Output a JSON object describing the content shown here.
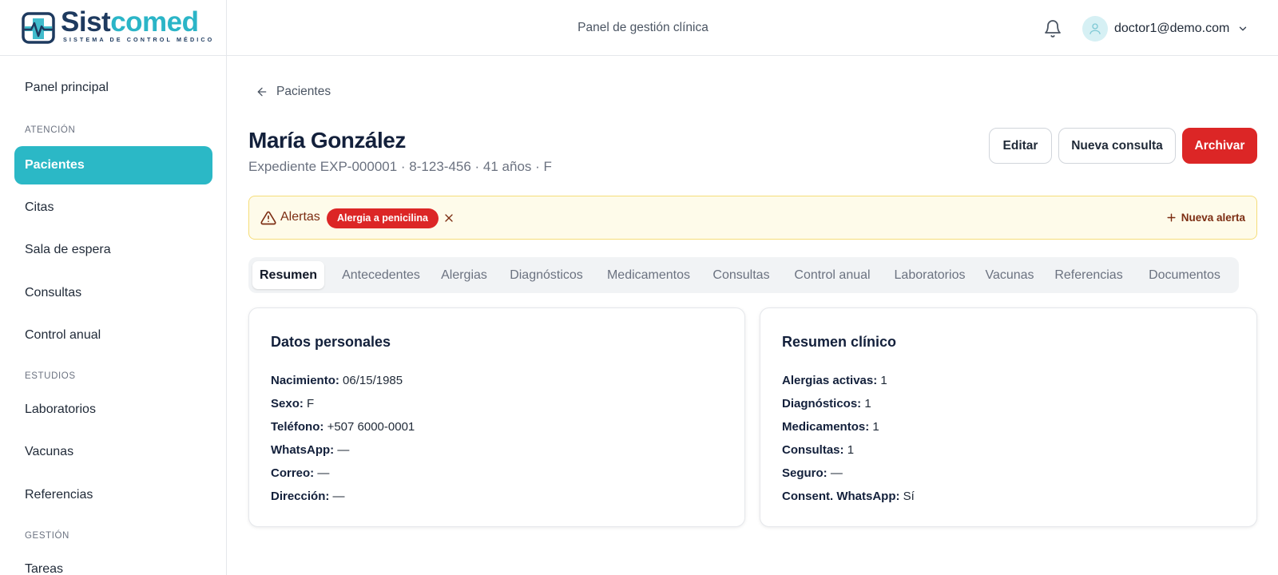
{
  "brand": {
    "name_part1": "Sist",
    "name_part2": "comed",
    "tagline": "SISTEMA DE CONTROL MÉDICO",
    "primary_color": "#1e3a5f",
    "accent_color": "#2bb5c7"
  },
  "header": {
    "title": "Panel de gestión clínica",
    "user_email": "doctor1@demo.com",
    "icons": [
      "bell-icon",
      "user-avatar-icon",
      "chevron-down-icon"
    ]
  },
  "sidebar": {
    "items": [
      {
        "label": "Panel principal"
      },
      {
        "section": "ATENCIÓN"
      },
      {
        "label": "Pacientes",
        "active": true
      },
      {
        "label": "Citas"
      },
      {
        "label": "Sala de espera"
      },
      {
        "label": "Consultas"
      },
      {
        "label": "Control anual"
      },
      {
        "section": "ESTUDIOS"
      },
      {
        "label": "Laboratorios"
      },
      {
        "label": "Vacunas"
      },
      {
        "label": "Referencias"
      },
      {
        "section": "GESTIÓN"
      },
      {
        "label": "Tareas"
      }
    ],
    "active_color": "#2bb8c6"
  },
  "main": {
    "back_label": "Pacientes",
    "patient": {
      "name": "María González",
      "meta": "Expediente EXP-000001 · 8-123-456 · 41 años · F"
    },
    "actions": {
      "edit": "Editar",
      "new_consultation": "Nueva consulta",
      "archive": "Archivar",
      "archive_color": "#dc2626"
    },
    "alerts": {
      "label": "Alertas",
      "chips": [
        "Alergia a penicilina"
      ],
      "new_alert": "Nueva alerta"
    },
    "tabs": [
      {
        "label": "Resumen",
        "active": true
      },
      {
        "label": "Antecedentes"
      },
      {
        "label": "Alergias"
      },
      {
        "label": "Diagnósticos"
      },
      {
        "label": "Medicamentos"
      },
      {
        "label": "Consultas"
      },
      {
        "label": "Control anual"
      },
      {
        "label": "Laboratorios"
      },
      {
        "label": "Vacunas"
      },
      {
        "label": "Referencias"
      },
      {
        "label": "Documentos"
      }
    ],
    "personal": {
      "title": "Datos personales",
      "fields": [
        {
          "key": "Nacimiento:",
          "value": "06/15/1985"
        },
        {
          "key": "Sexo:",
          "value": "F"
        },
        {
          "key": "Teléfono:",
          "value": "+507 6000-0001"
        },
        {
          "key": "WhatsApp:",
          "value": "—"
        },
        {
          "key": "Correo:",
          "value": "—"
        },
        {
          "key": "Dirección:",
          "value": "—"
        }
      ]
    },
    "clinical": {
      "title": "Resumen clínico",
      "fields": [
        {
          "key": "Alergias activas:",
          "value": "1"
        },
        {
          "key": "Diagnósticos:",
          "value": "1"
        },
        {
          "key": "Medicamentos:",
          "value": "1"
        },
        {
          "key": "Consultas:",
          "value": "1"
        },
        {
          "key": "Seguro:",
          "value": "—"
        },
        {
          "key": "Consent. WhatsApp:",
          "value": "Sí"
        }
      ]
    }
  }
}
